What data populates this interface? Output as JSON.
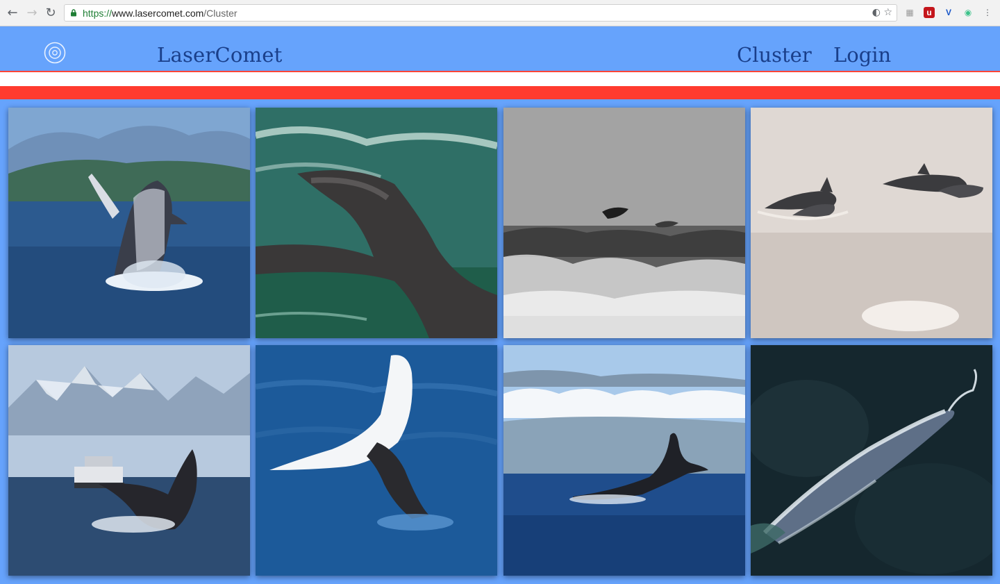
{
  "browser": {
    "url_scheme": "https://",
    "url_host": "www.lasercomet.com",
    "url_path": "/Cluster"
  },
  "site": {
    "brand": "LaserComet",
    "logo_icon": "atom-ring-icon",
    "nav": [
      {
        "label": "Cluster"
      },
      {
        "label": "Login"
      }
    ],
    "colors": {
      "background": "#66a3fc",
      "accent_red": "#ff3b2f",
      "brand_text": "#1a3f8a"
    }
  },
  "gallery": {
    "images": [
      {
        "subject": "breaching humpback whale"
      },
      {
        "subject": "whale tail fluke in green water"
      },
      {
        "subject": "dolphins jumping over waves, black and white"
      },
      {
        "subject": "dolphins swimming in calm water"
      },
      {
        "subject": "humpback whale breaching near ship"
      },
      {
        "subject": "white whale tail above blue water"
      },
      {
        "subject": "whale tail under clouds and mountains"
      },
      {
        "subject": "blue whale aerial view"
      }
    ]
  }
}
